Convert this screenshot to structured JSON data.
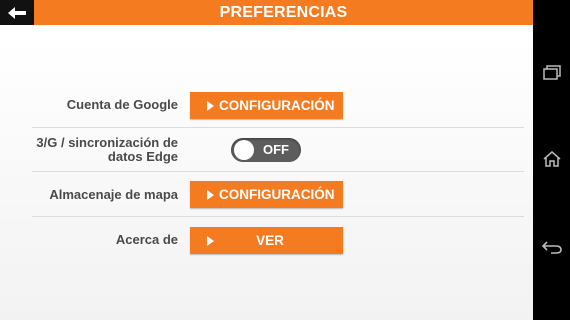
{
  "header": {
    "title": "PREFERENCIAS",
    "back_icon": "back-arrow-icon"
  },
  "settings": [
    {
      "label": "Cuenta de Google",
      "button": "CONFIGURACIÓN"
    },
    {
      "label_line1": "3/G / sincronización de",
      "label_line2": "datos Edge",
      "toggle": "OFF"
    },
    {
      "label": "Almacenaje de mapa",
      "button": "CONFIGURACIÓN"
    },
    {
      "label": "Acerca de",
      "button": "VER"
    }
  ],
  "navbar": {
    "icons": [
      "recent-apps-icon",
      "home-icon",
      "back-icon"
    ]
  },
  "colors": {
    "accent": "#f47b20",
    "toggle_off": "#5d5d5d",
    "label": "#4a4a4a"
  }
}
